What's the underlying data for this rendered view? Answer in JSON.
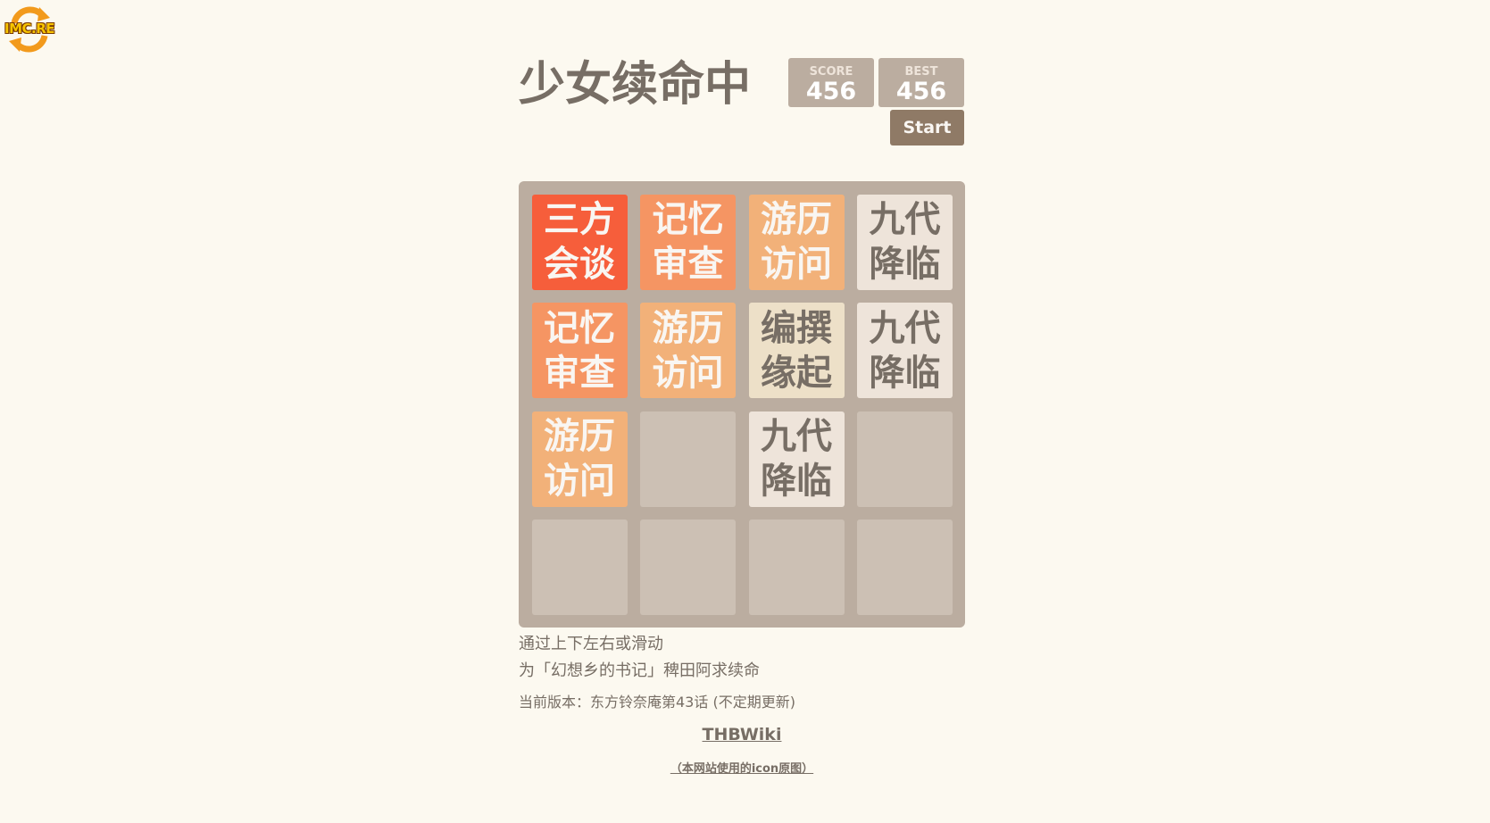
{
  "logo": {
    "text": "IMC.RE"
  },
  "header": {
    "title": "少女续命中",
    "score_label": "SCORE",
    "score_value": "456",
    "best_label": "BEST",
    "best_value": "456",
    "start_label": "Start"
  },
  "board": {
    "rows": [
      [
        {
          "label": "三方会谈",
          "style": "t-red2"
        },
        {
          "label": "记忆审查",
          "style": "t-orange2"
        },
        {
          "label": "游历访问",
          "style": "t-orange1"
        },
        {
          "label": "九代降临",
          "style": "t-light"
        }
      ],
      [
        {
          "label": "记忆审查",
          "style": "t-orange2"
        },
        {
          "label": "游历访问",
          "style": "t-orange1"
        },
        {
          "label": "编撰缘起",
          "style": "t-beige"
        },
        {
          "label": "九代降临",
          "style": "t-light"
        }
      ],
      [
        {
          "label": "游历访问",
          "style": "t-orange1"
        },
        {
          "label": "",
          "style": "empty"
        },
        {
          "label": "九代降临",
          "style": "t-light"
        },
        {
          "label": "",
          "style": "empty"
        }
      ],
      [
        {
          "label": "",
          "style": "empty"
        },
        {
          "label": "",
          "style": "empty"
        },
        {
          "label": "",
          "style": "empty"
        },
        {
          "label": "",
          "style": "empty"
        }
      ]
    ]
  },
  "footer": {
    "instructions_line1": "通过上下左右或滑动",
    "instructions_line2": "为「幻想乡的书记」稗田阿求续命",
    "version": "当前版本：东方铃奈庵第43话 (不定期更新)",
    "wiki_link": "THBWiki",
    "icon_link": "（本网站使用的icon原图）"
  },
  "colors": {
    "background": "#fcf9f0",
    "grid": "#bbada0",
    "text": "#776e65",
    "button": "#8f7a66"
  }
}
